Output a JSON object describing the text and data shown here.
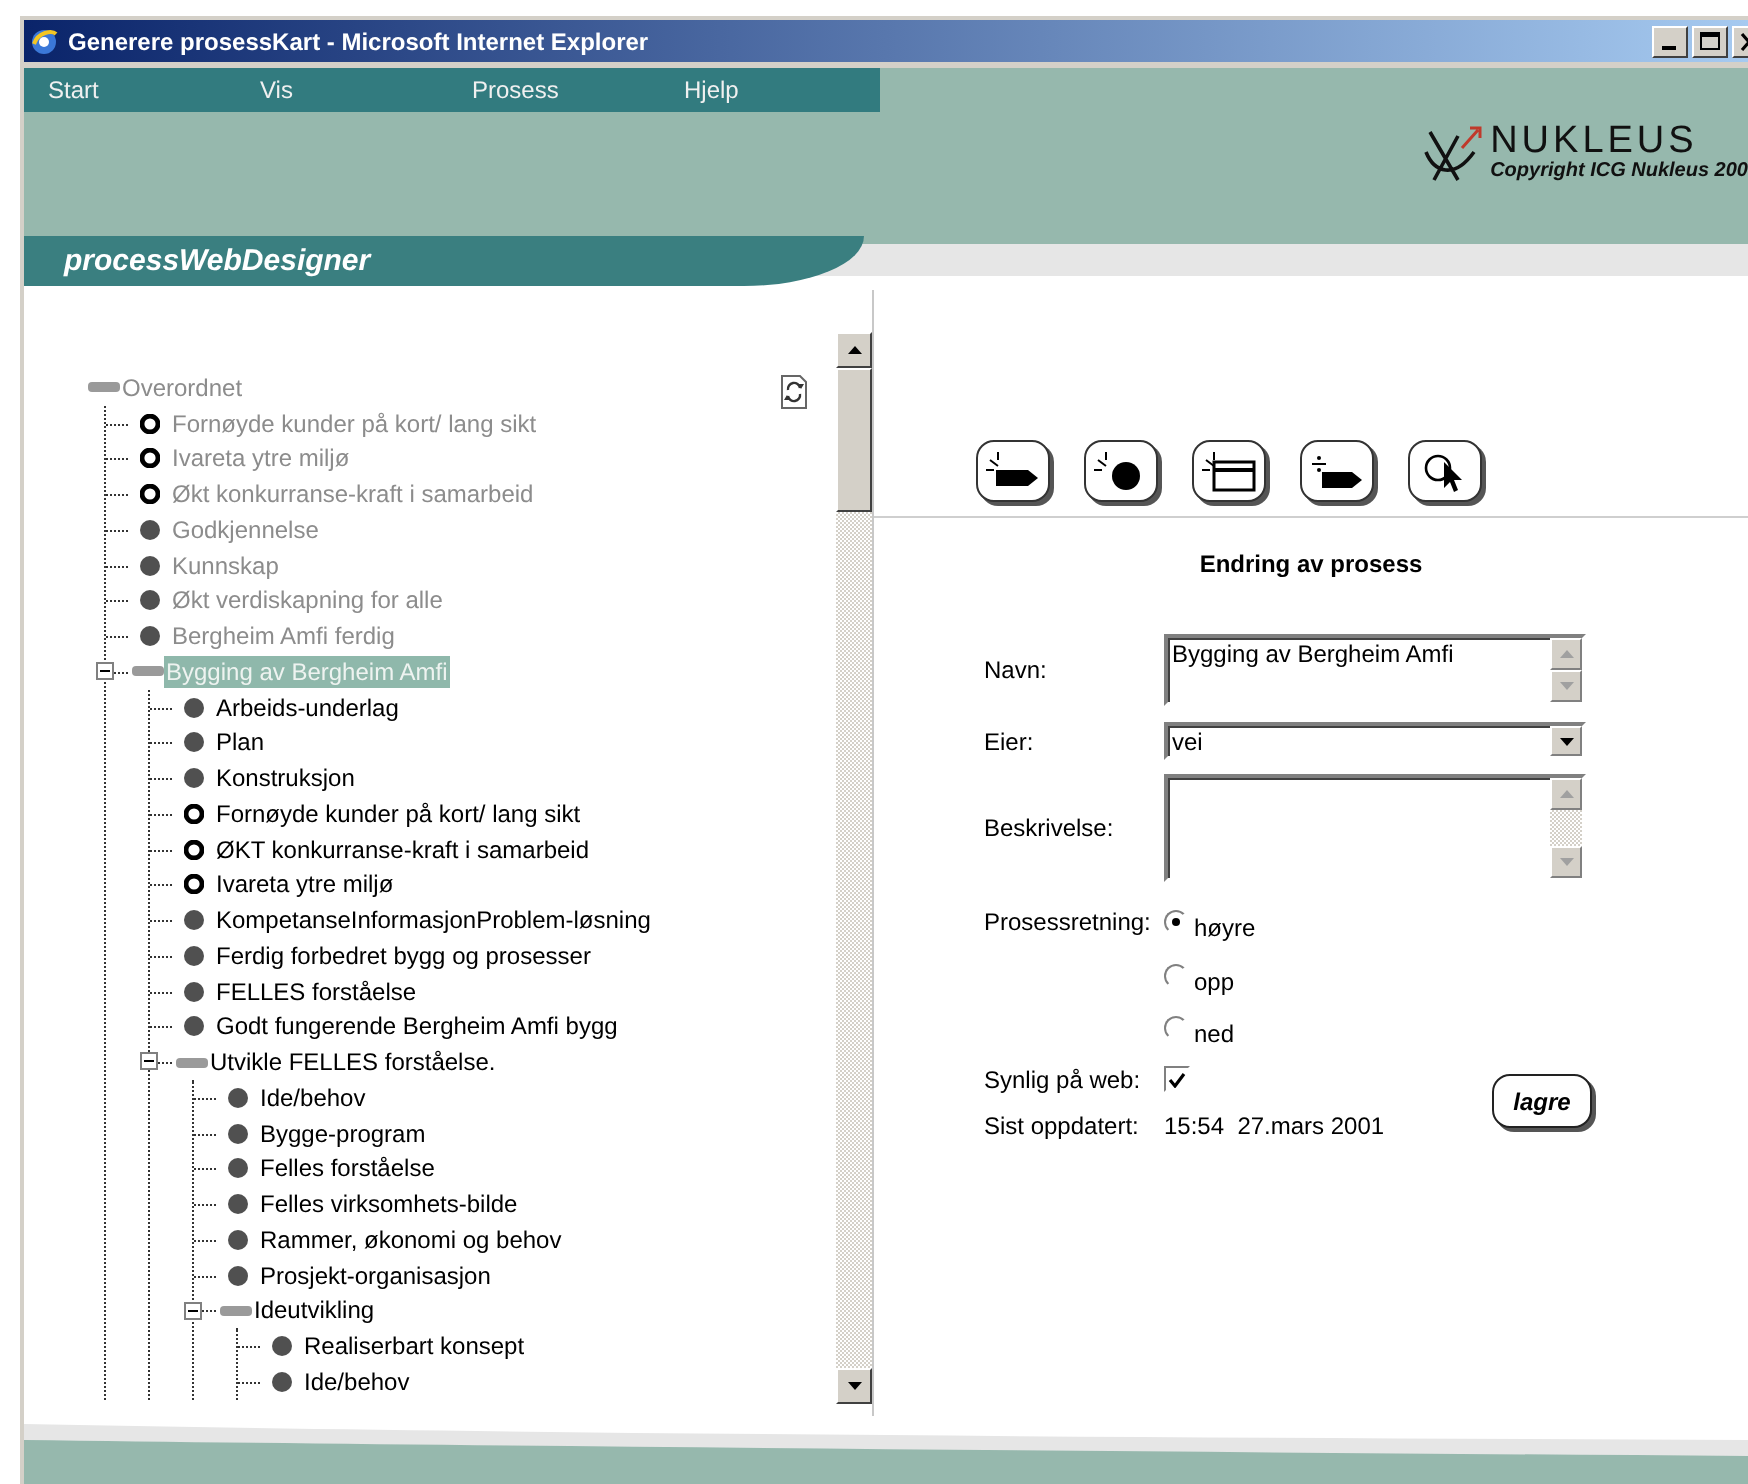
{
  "window": {
    "title": "Generere prosessKart - Microsoft Internet Explorer"
  },
  "menu": [
    "Start",
    "Vis",
    "Prosess",
    "Hjelp"
  ],
  "logo": {
    "name": "NUKLEUS",
    "copyright": "Copyright ICG Nukleus 200"
  },
  "app_title": "processWebDesigner",
  "tree": {
    "nodes": [
      {
        "label": "Overordnet",
        "kind": "group",
        "disabled": true,
        "selected": false,
        "children": [
          {
            "label": "Fornøyde kunder på kort/ lang sikt",
            "kind": "goal",
            "disabled": true,
            "selected": false
          },
          {
            "label": "Ivareta ytre miljø",
            "kind": "goal",
            "disabled": true,
            "selected": false
          },
          {
            "label": "Økt konkurranse-kraft i samarbeid",
            "kind": "goal",
            "disabled": true,
            "selected": false
          },
          {
            "label": "Godkjennelse",
            "kind": "process",
            "disabled": true,
            "selected": false
          },
          {
            "label": "Kunnskap",
            "kind": "process",
            "disabled": true,
            "selected": false
          },
          {
            "label": "Økt verdiskapning for alle",
            "kind": "process",
            "disabled": true,
            "selected": false
          },
          {
            "label": "Bergheim Amfi ferdig",
            "kind": "process",
            "disabled": true,
            "selected": false
          },
          {
            "label": "Bygging av Bergheim Amfi",
            "kind": "group",
            "disabled": true,
            "selected": true,
            "expanded": true,
            "children": [
              {
                "label": "Arbeids-underlag",
                "kind": "process",
                "disabled": false,
                "selected": false
              },
              {
                "label": "Plan",
                "kind": "process",
                "disabled": false,
                "selected": false
              },
              {
                "label": "Konstruksjon",
                "kind": "process",
                "disabled": false,
                "selected": false
              },
              {
                "label": "Fornøyde kunder på kort/ lang sikt",
                "kind": "goal",
                "disabled": false,
                "selected": false
              },
              {
                "label": "ØKT konkurranse-kraft i samarbeid",
                "kind": "goal",
                "disabled": false,
                "selected": false
              },
              {
                "label": "Ivareta ytre miljø",
                "kind": "goal",
                "disabled": false,
                "selected": false
              },
              {
                "label": "KompetanseInformasjonProblem-løsning",
                "kind": "process",
                "disabled": false,
                "selected": false
              },
              {
                "label": "Ferdig forbedret bygg og prosesser",
                "kind": "process",
                "disabled": false,
                "selected": false
              },
              {
                "label": "FELLES forståelse",
                "kind": "process",
                "disabled": false,
                "selected": false
              },
              {
                "label": "Godt fungerende Bergheim Amfi bygg",
                "kind": "process",
                "disabled": false,
                "selected": false
              },
              {
                "label": "Utvikle FELLES forståelse.",
                "kind": "group",
                "disabled": false,
                "selected": false,
                "expanded": true,
                "children": [
                  {
                    "label": "Ide/behov",
                    "kind": "process",
                    "disabled": false,
                    "selected": false
                  },
                  {
                    "label": "Bygge-program",
                    "kind": "process",
                    "disabled": false,
                    "selected": false
                  },
                  {
                    "label": "Felles forståelse",
                    "kind": "process",
                    "disabled": false,
                    "selected": false
                  },
                  {
                    "label": "Felles virksomhets-bilde",
                    "kind": "process",
                    "disabled": false,
                    "selected": false
                  },
                  {
                    "label": "Rammer, økonomi og behov",
                    "kind": "process",
                    "disabled": false,
                    "selected": false
                  },
                  {
                    "label": "Prosjekt-organisasjon",
                    "kind": "process",
                    "disabled": false,
                    "selected": false
                  },
                  {
                    "label": "Ideutvikling",
                    "kind": "group",
                    "disabled": false,
                    "selected": false,
                    "expanded": true,
                    "children": [
                      {
                        "label": "Realiserbart konsept",
                        "kind": "process",
                        "disabled": false,
                        "selected": false
                      },
                      {
                        "label": "Ide/behov",
                        "kind": "process",
                        "disabled": false,
                        "selected": false
                      }
                    ]
                  }
                ]
              }
            ]
          }
        ]
      }
    ]
  },
  "toolbar": [
    {
      "kind": "arrow"
    },
    {
      "kind": "circle"
    },
    {
      "kind": "window"
    },
    {
      "kind": "divide"
    },
    {
      "kind": "pointer"
    }
  ],
  "form": {
    "title": "Endring av prosess",
    "fields": [
      {
        "kind": "textarea",
        "label": "Navn:",
        "value": "Bygging av Bergheim Amfi"
      },
      {
        "kind": "select",
        "label": "Eier:",
        "value": "vei"
      },
      {
        "kind": "textarea",
        "label": "Beskrivelse:"
      }
    ],
    "direction": {
      "label": "Prosessretning:",
      "options": [
        {
          "label": "høyre",
          "selected": true
        },
        {
          "label": "opp",
          "selected": false
        },
        {
          "label": "ned",
          "selected": false
        }
      ]
    },
    "visible": {
      "label": "Synlig på web:",
      "checked": true
    },
    "updated": {
      "label": "Sist oppdatert:",
      "value": "15:54  27.mars 2001"
    },
    "save_button": "lagre"
  }
}
